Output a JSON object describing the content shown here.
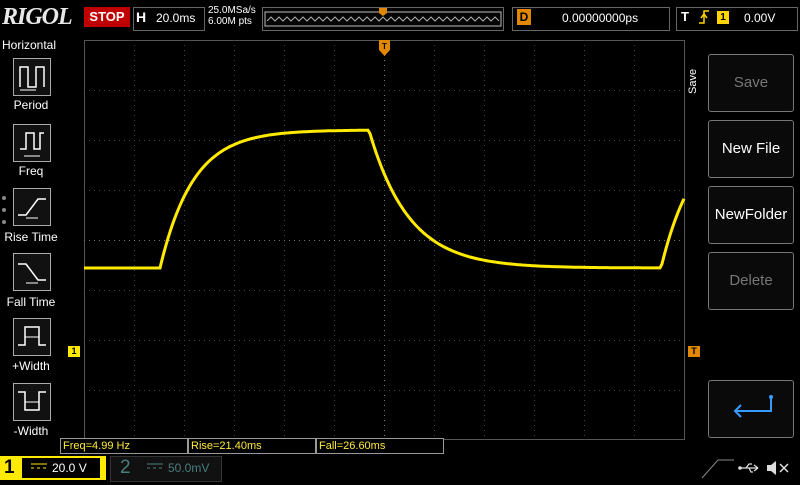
{
  "header": {
    "brand": "RIGOL",
    "run_state": "STOP",
    "horizontal_letter": "H",
    "timebase": "20.0ms",
    "sample_rate": "25.0MSa/s",
    "memory_depth": "6.00M pts",
    "delay_letter": "D",
    "delay_value": "0.00000000ps",
    "trigger_letter": "T",
    "trigger_edge": "rising",
    "trigger_channel": "1",
    "trigger_level": "0.00V"
  },
  "left_menu": {
    "title": "Horizontal",
    "items": [
      {
        "label": "Period",
        "icon": "period-icon"
      },
      {
        "label": "Freq",
        "icon": "frequency-icon"
      },
      {
        "label": "Rise Time",
        "icon": "rise-time-icon"
      },
      {
        "label": "Fall Time",
        "icon": "fall-time-icon"
      },
      {
        "label": "+Width",
        "icon": "positive-width-icon"
      },
      {
        "label": "-Width",
        "icon": "negative-width-icon"
      }
    ]
  },
  "right_menu": {
    "title": "Save",
    "items": [
      {
        "label": "Save",
        "enabled": false
      },
      {
        "label": "New File",
        "enabled": true
      },
      {
        "label": "NewFolder",
        "enabled": true
      },
      {
        "label": "Delete",
        "enabled": false
      }
    ],
    "return_icon": "return-arrow-icon"
  },
  "measurements": {
    "freq": "Freq=4.99 Hz",
    "rise": "Rise=21.40ms",
    "fall": "Fall=26.60ms"
  },
  "channels": {
    "ch1": {
      "number": "1",
      "scale": "20.0 V",
      "color": "#ffea00"
    },
    "ch2": {
      "number": "2",
      "scale": "50.0mV",
      "color": "#4a7d7d"
    }
  },
  "markers": {
    "ch1_ground": "1",
    "trigger_marker": "T"
  },
  "status_icons": [
    "usb-icon",
    "speaker-muted-icon"
  ],
  "colors": {
    "trace": "#ffea00",
    "trigger_marker": "#e28800",
    "stop": "#c00000"
  }
}
